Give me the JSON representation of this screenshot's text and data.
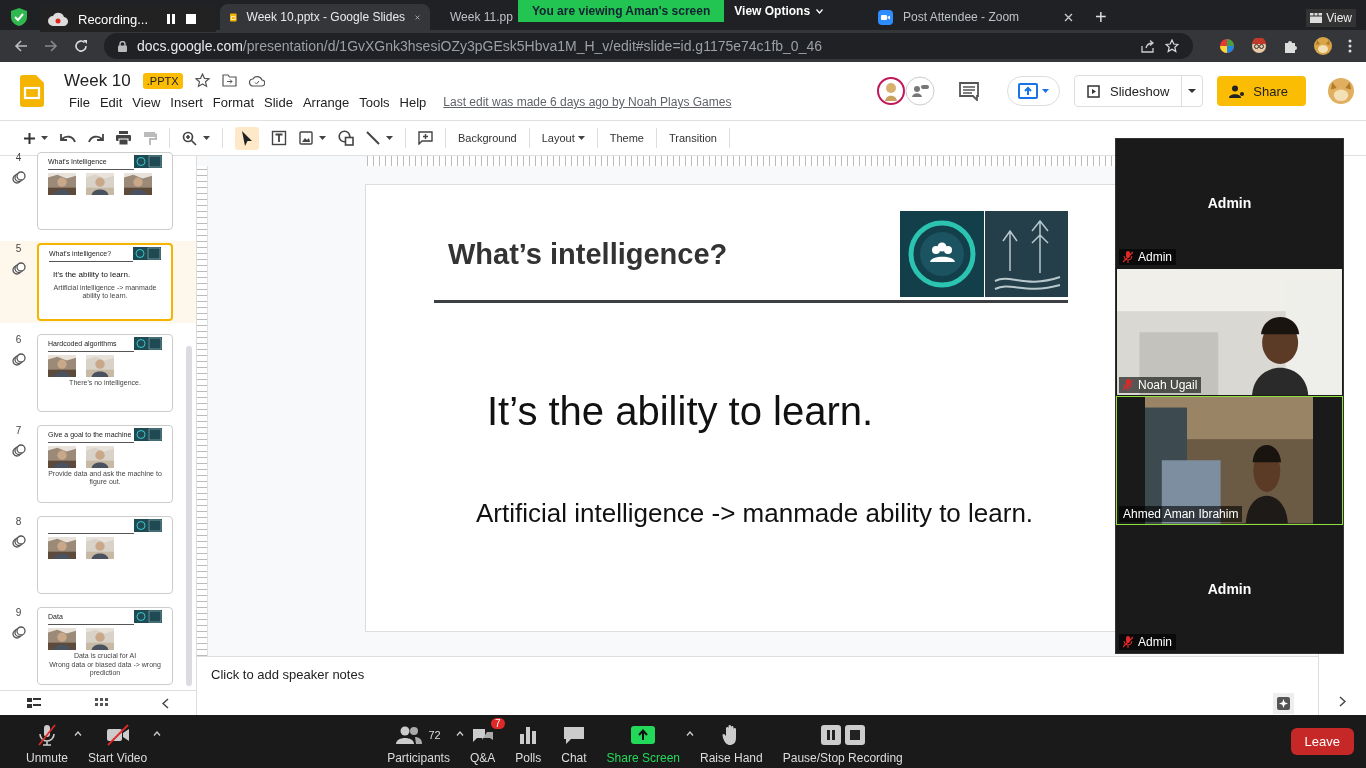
{
  "recording": {
    "label": "Recording..."
  },
  "banner": {
    "text": "You are viewing Aman's screen",
    "options": "View Options"
  },
  "tabs": [
    {
      "title": "Week 10.pptx - Google Slides",
      "selected": true,
      "kind": "slides"
    },
    {
      "title": "Week 11.pp",
      "selected": false,
      "kind": "slides"
    },
    {
      "title": "Post Attendee - Zoom",
      "selected": false,
      "kind": "zoom"
    }
  ],
  "new_tab": "+",
  "view_button": "View",
  "address": {
    "host": "docs.google.com",
    "path": "/presentation/d/1GvXGnk3hsesiOZy3pGEsk5Hbva1M_H_v/edit#slide=id.g1175e74c1fb_0_46"
  },
  "doc": {
    "title": "Week 10",
    "badge": ".PPTX",
    "menus": [
      "File",
      "Edit",
      "View",
      "Insert",
      "Format",
      "Slide",
      "Arrange",
      "Tools",
      "Help"
    ],
    "last_edit": "Last edit was made 6 days ago by Noah Plays Games"
  },
  "slideshow": "Slideshow",
  "share": "Share",
  "toolbar": [
    "Background",
    "Layout",
    "Theme",
    "Transition"
  ],
  "filmstrip": [
    {
      "number": "4",
      "selected": false,
      "title": "What's Intelligence",
      "media": [
        {
          "kind": "picture"
        },
        {
          "kind": "picture"
        },
        {
          "kind": "picture"
        }
      ]
    },
    {
      "number": "5",
      "selected": true,
      "title": "What's intelligence?",
      "lines": [
        "It's the ability to learn.",
        "Artificial intelligence -> manmade ability to learn."
      ]
    },
    {
      "number": "6",
      "selected": false,
      "title": "Hardcoded algorithms",
      "lines": [
        "There's no intelligence."
      ],
      "media": [
        {
          "kind": "picture"
        },
        {
          "kind": "picture"
        }
      ]
    },
    {
      "number": "7",
      "selected": false,
      "title": "Give a goal to the machine",
      "lines": [
        "Provide data and ask the machine to figure out."
      ],
      "media": [
        {
          "kind": "picture"
        },
        {
          "kind": "picture"
        }
      ]
    },
    {
      "number": "8",
      "selected": false,
      "media": [
        {
          "kind": "picture"
        },
        {
          "kind": "picture"
        }
      ]
    },
    {
      "number": "9",
      "selected": false,
      "title": "Data",
      "lines": [
        "Data is crucial for AI",
        "Wrong data or biased data -> wrong prediction"
      ],
      "media": [
        {
          "kind": "picture"
        },
        {
          "kind": "picture"
        }
      ]
    }
  ],
  "slide": {
    "title": "What’s intelligence?",
    "line_1": "It’s the ability to learn.",
    "line_2": "Artificial intelligence -> manmade ability to learn."
  },
  "notes": "Click to add speaker notes",
  "gallery": [
    {
      "name": "Admin",
      "label": "Admin",
      "video": false,
      "speaking": false,
      "muted": true
    },
    {
      "label": "Noah Ugail",
      "video": true,
      "speaking": false,
      "muted": true
    },
    {
      "label": "Ahmed Aman Ibrahim",
      "video": true,
      "speaking": true,
      "muted": false
    },
    {
      "name": "Admin",
      "label": "Admin",
      "video": false,
      "speaking": false,
      "muted": true
    }
  ],
  "zoom_bar": [
    {
      "kind": "mic",
      "label": "Unmute",
      "caret": true
    },
    {
      "kind": "video",
      "label": "Start Video",
      "caret": true
    },
    {
      "kind": "participants",
      "label": "Participants",
      "count": "72",
      "caret": true
    },
    {
      "kind": "qa",
      "label": "Q&A",
      "badge": "7",
      "caret": false
    },
    {
      "kind": "polls",
      "label": "Polls",
      "caret": false
    },
    {
      "kind": "chat",
      "label": "Chat",
      "caret": false
    },
    {
      "kind": "share",
      "label": "Share Screen",
      "caret": true
    },
    {
      "kind": "hand",
      "label": "Raise Hand",
      "caret": false
    },
    {
      "kind": "record",
      "label": "Pause/Stop Recording",
      "caret": false
    }
  ],
  "leave": "Leave"
}
